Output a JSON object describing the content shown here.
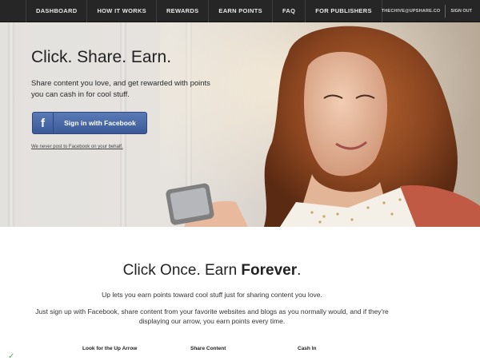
{
  "nav": {
    "items": [
      {
        "label": "DASHBOARD"
      },
      {
        "label": "HOW IT WORKS"
      },
      {
        "label": "REWARDS"
      },
      {
        "label": "EARN POINTS"
      },
      {
        "label": "FAQ"
      },
      {
        "label": "FOR PUBLISHERS"
      }
    ],
    "user": "THECHIVE@UPSHARE.CO",
    "signout": "SIGN OUT"
  },
  "hero": {
    "title": "Click. Share. Earn.",
    "subtitle": "Share content you love, and get rewarded with points you can cash in for cool stuff.",
    "fb_button_label": "Sign in with Facebook",
    "fb_icon_glyph": "f",
    "note": "We never post to Facebook on your behalf."
  },
  "section": {
    "title_prefix": "Click Once. Earn ",
    "title_bold": "Forever",
    "title_suffix": ".",
    "p1": "Up lets you earn points toward cool stuff just for sharing content you love.",
    "p2": "Just sign up with Facebook, share content from your favorite websites and blogs as you normally would, and if they're displaying our arrow, you earn points every time.",
    "steps": [
      "Look for the Up Arrow",
      "Share Content",
      "Cash In"
    ]
  },
  "colors": {
    "nav_bg": "#262626",
    "facebook_blue": "#3b5998"
  }
}
